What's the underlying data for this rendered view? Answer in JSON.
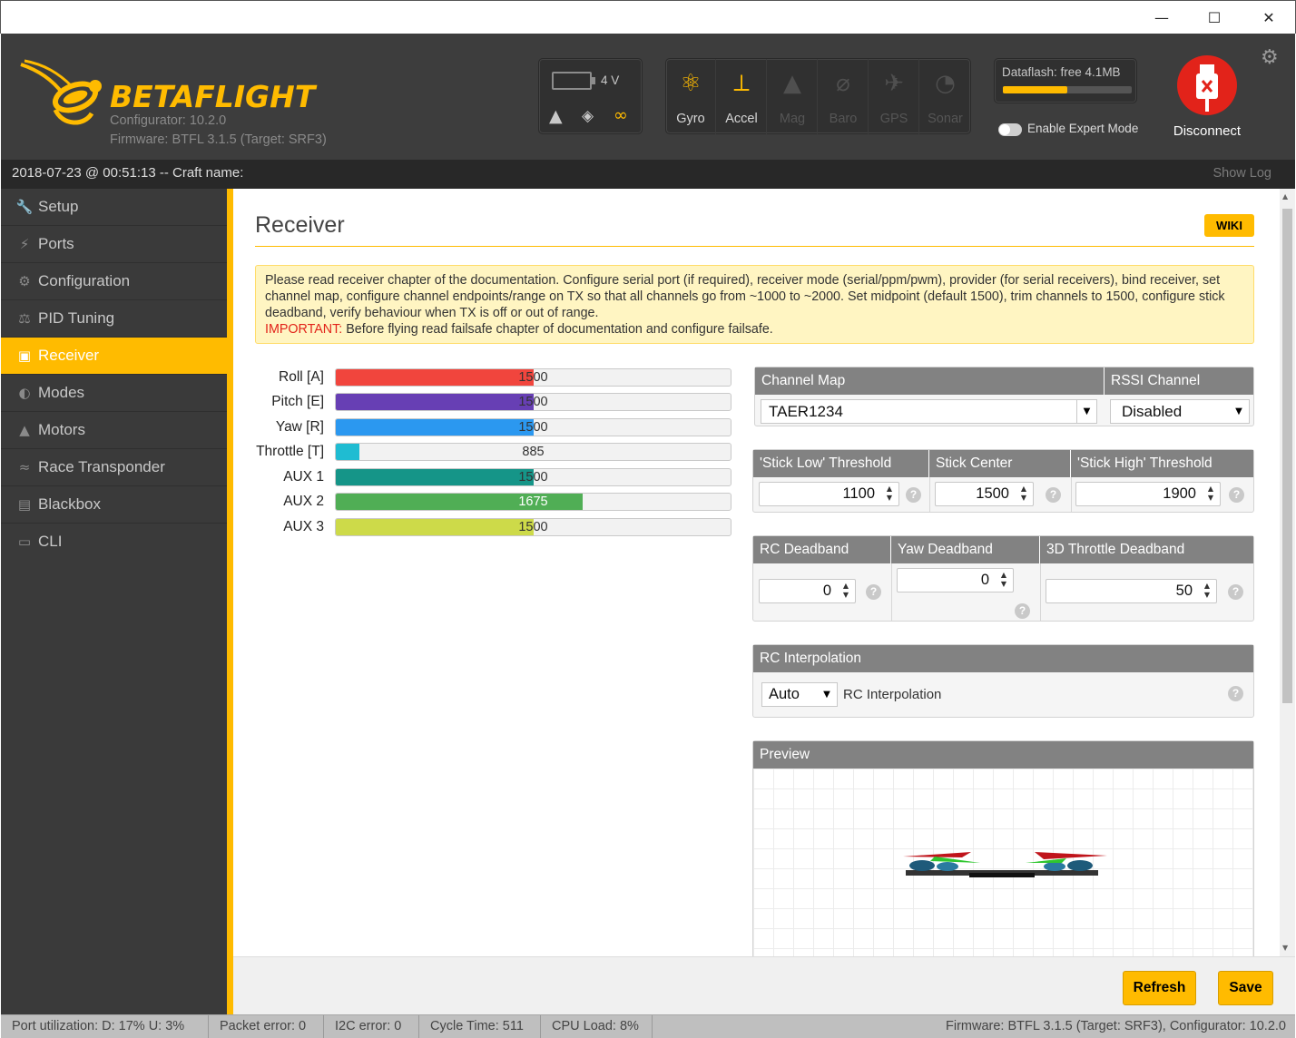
{
  "window": {
    "minimize_glyph": "—",
    "maximize_glyph": "☐",
    "close_glyph": "✕"
  },
  "header": {
    "logo_part1": "BETA",
    "logo_part2": "FLIGHT",
    "configurator_version": "Configurator: 10.2.0",
    "firmware": "Firmware: BTFL 3.1.5 (Target: SRF3)",
    "battery_voltage": "4 V",
    "sensors": [
      {
        "label": "Gyro",
        "icon": "gyro-icon",
        "active": true
      },
      {
        "label": "Accel",
        "icon": "accel-icon",
        "active": true
      },
      {
        "label": "Mag",
        "icon": "mag-icon",
        "active": false
      },
      {
        "label": "Baro",
        "icon": "baro-icon",
        "active": false
      },
      {
        "label": "GPS",
        "icon": "gps-icon",
        "active": false
      },
      {
        "label": "Sonar",
        "icon": "sonar-icon",
        "active": false
      }
    ],
    "dataflash": "Dataflash: free 4.1MB",
    "dataflash_used_fraction": 0.5,
    "expert_mode_label": "Enable Expert Mode",
    "disconnect_label": "Disconnect",
    "accent_color": "#ffbb00",
    "disconnect_color": "#e2231a"
  },
  "status": {
    "left": "2018-07-23 @ 00:51:13 -- Craft name:",
    "show_log": "Show Log"
  },
  "sidebar": {
    "items": [
      {
        "label": "Setup",
        "icon": "wrench-icon",
        "active": false
      },
      {
        "label": "Ports",
        "icon": "plug-icon",
        "active": false
      },
      {
        "label": "Configuration",
        "icon": "gear-icon",
        "active": false
      },
      {
        "label": "PID Tuning",
        "icon": "pid-icon",
        "active": false
      },
      {
        "label": "Receiver",
        "icon": "receiver-icon",
        "active": true
      },
      {
        "label": "Modes",
        "icon": "modes-icon",
        "active": false
      },
      {
        "label": "Motors",
        "icon": "motor-icon",
        "active": false
      },
      {
        "label": "Race Transponder",
        "icon": "transponder-icon",
        "active": false
      },
      {
        "label": "Blackbox",
        "icon": "blackbox-icon",
        "active": false
      },
      {
        "label": "CLI",
        "icon": "terminal-icon",
        "active": false
      }
    ]
  },
  "main": {
    "title": "Receiver",
    "wiki": "WIKI",
    "note_text": "Please read receiver chapter of the documentation. Configure serial port (if required), receiver mode (serial/ppm/pwm), provider (for serial receivers), bind receiver, set channel map, configure channel endpoints/range on TX so that all channels go from ~1000 to ~2000. Set midpoint (default 1500), trim channels to 1500, configure stick deadband, verify behaviour when TX is off or out of range.",
    "note_important_label": "IMPORTANT:",
    "note_important_text": " Before flying read failsafe chapter of documentation and configure failsafe.",
    "channels": [
      {
        "name": "Roll [A]",
        "value": "1500",
        "fraction": 0.5,
        "color": "#f1453d"
      },
      {
        "name": "Pitch [E]",
        "value": "1500",
        "fraction": 0.5,
        "color": "#673fb4"
      },
      {
        "name": "Yaw [R]",
        "value": "1500",
        "fraction": 0.5,
        "color": "#2b98f0"
      },
      {
        "name": "Throttle [T]",
        "value": "885",
        "fraction": 0.06,
        "color": "#1fbcd2"
      },
      {
        "name": "AUX 1",
        "value": "1500",
        "fraction": 0.5,
        "color": "#159588"
      },
      {
        "name": "AUX 2",
        "value": "1675",
        "fraction": 0.625,
        "color": "#50ae55"
      },
      {
        "name": "AUX 3",
        "value": "1500",
        "fraction": 0.5,
        "color": "#cdda49"
      }
    ],
    "channel_map_label": "Channel Map",
    "channel_map_value": "TAER1234",
    "rssi_label": "RSSI Channel",
    "rssi_value": "Disabled",
    "stick_low_label": "'Stick Low' Threshold",
    "stick_low_value": "1100",
    "stick_center_label": "Stick Center",
    "stick_center_value": "1500",
    "stick_high_label": "'Stick High' Threshold",
    "stick_high_value": "1900",
    "rc_deadband_label": "RC Deadband",
    "rc_deadband_value": "0",
    "yaw_deadband_label": "Yaw Deadband",
    "yaw_deadband_value": "0",
    "throttle_deadband_label": "3D Throttle Deadband",
    "throttle_deadband_value": "50",
    "rc_interp_header": "RC Interpolation",
    "rc_interp_value": "Auto",
    "rc_interp_label": "RC Interpolation",
    "preview_label": "Preview",
    "refresh_label": "Refresh",
    "save_label": "Save"
  },
  "footer": {
    "port_util": "Port utilization: D: 17% U: 3%",
    "packet_error": "Packet error: 0",
    "i2c_error": "I2C error: 0",
    "cycle_time": "Cycle Time: 511",
    "cpu_load": "CPU Load: 8%",
    "versions": "Firmware: BTFL 3.1.5 (Target: SRF3), Configurator: 10.2.0"
  }
}
